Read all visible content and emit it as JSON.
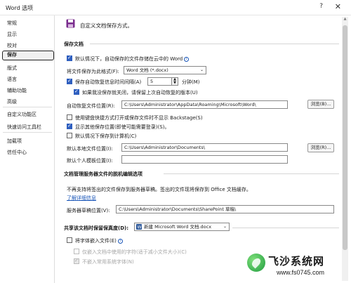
{
  "window": {
    "title": "Word 选项",
    "help": "?",
    "close": "✕"
  },
  "sidebar": {
    "items": [
      "常规",
      "显示",
      "校对",
      "保存",
      "版式",
      "语言",
      "辅助功能",
      "高级",
      "自定义功能区",
      "快速访问工具栏",
      "加载项",
      "信任中心"
    ],
    "active": "保存"
  },
  "header": {
    "text": "自定义文档保存方式。",
    "icon": "floppy-disk-icon"
  },
  "save_docs": {
    "heading": "保存文档",
    "autosave_cloud": {
      "label": "默认情况下，自动保存的文件存储在云中的 Word",
      "checked": true
    },
    "format_label": "将文件保存为此格式(F):",
    "format_value": "Word 文档 (*.docx)",
    "autorecover": {
      "label": "保存自动恢复信息时间间隔(A)",
      "checked": true,
      "minutes": "5",
      "unit": "分钟(M)"
    },
    "keep_last": {
      "label": "如果我没保存就关闭，请保留上次自动恢复的版本(U)",
      "checked": true
    },
    "autorecover_path_label": "自动恢复文件位置(R):",
    "autorecover_path": "C:\\Users\\Administrator\\AppData\\Roaming\\Microsoft\\Word\\",
    "browse1": "浏览(B)...",
    "backstage": {
      "label": "使用键盘快捷方式打开或保存文件时不显示 Backstage(S)",
      "checked": false
    },
    "show_other": {
      "label": "显示其他保存位置(即使可能需要登录)(S)。",
      "checked": true
    },
    "save_local": {
      "label": "默认情况下保存到计算机(C)",
      "checked": false
    },
    "local_path_label": "默认本地文件位置(I):",
    "local_path": "C:\\Users\\Administrator\\Documents\\",
    "browse2": "浏览(R)...",
    "template_label": "默认个人模板位置(I):",
    "template_value": ""
  },
  "offline": {
    "heading": "文档管理服务器文件的脱机编辑选项",
    "note": "不再支持将签出的文件保存到服务器草稿。签出的文件现将保存到 Office 文档缓存。",
    "learn_more": "了解详细信息",
    "drafts_label": "服务器草稿位置(V):",
    "drafts_value": "C:\\Users\\Administrator\\Documents\\SharePoint 草稿\\"
  },
  "fidelity": {
    "heading": "共享该文档时保留保真度(D):",
    "doc_value": "新建 Microsoft Word 文档.docx",
    "embed_fonts": {
      "label": "将字体嵌入文件(E)",
      "checked": false
    },
    "only_used": {
      "label": "仅嵌入文档中使用的字符(适于减小文件大小)(C)",
      "checked": false
    },
    "no_common": {
      "label": "不嵌入常用系统字体(N)",
      "checked": true
    }
  },
  "watermark": {
    "title": "飞沙系统网",
    "url": "www.fs0745.com"
  },
  "colors": {
    "accent": "#2f5fbf",
    "link": "#1a56b8"
  }
}
